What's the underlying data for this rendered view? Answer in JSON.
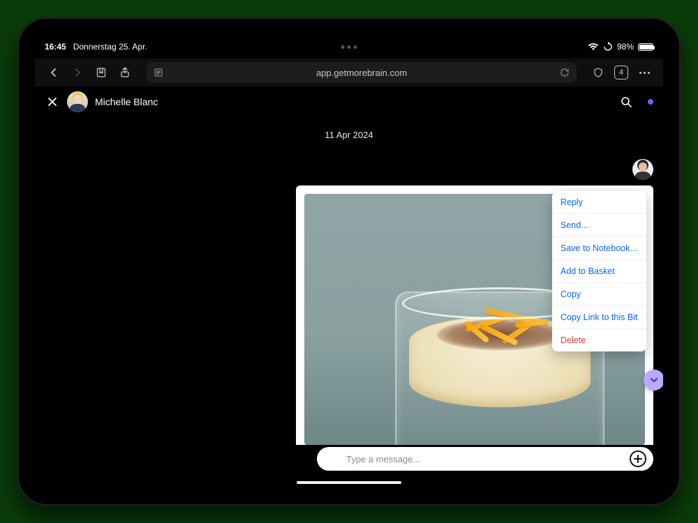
{
  "status": {
    "time": "16:45",
    "date": "Donnerstag 25. Apr.",
    "battery_pct": "98%"
  },
  "browser": {
    "url": "app.getmorebrain.com",
    "tab_count": "4"
  },
  "chat": {
    "contact_name": "Michelle Blanc",
    "date_separator": "11 Apr 2024",
    "composer_placeholder": "Type a message..."
  },
  "context_menu": {
    "items": [
      {
        "label": "Reply",
        "danger": false
      },
      {
        "label": "Send...",
        "danger": false
      },
      {
        "label": "Save to Notebook...",
        "danger": false
      },
      {
        "label": "Add to Basket",
        "danger": false
      },
      {
        "label": "Copy",
        "danger": false
      },
      {
        "label": "Copy Link to this Bit",
        "danger": false
      },
      {
        "label": "Delete",
        "danger": true
      }
    ]
  }
}
